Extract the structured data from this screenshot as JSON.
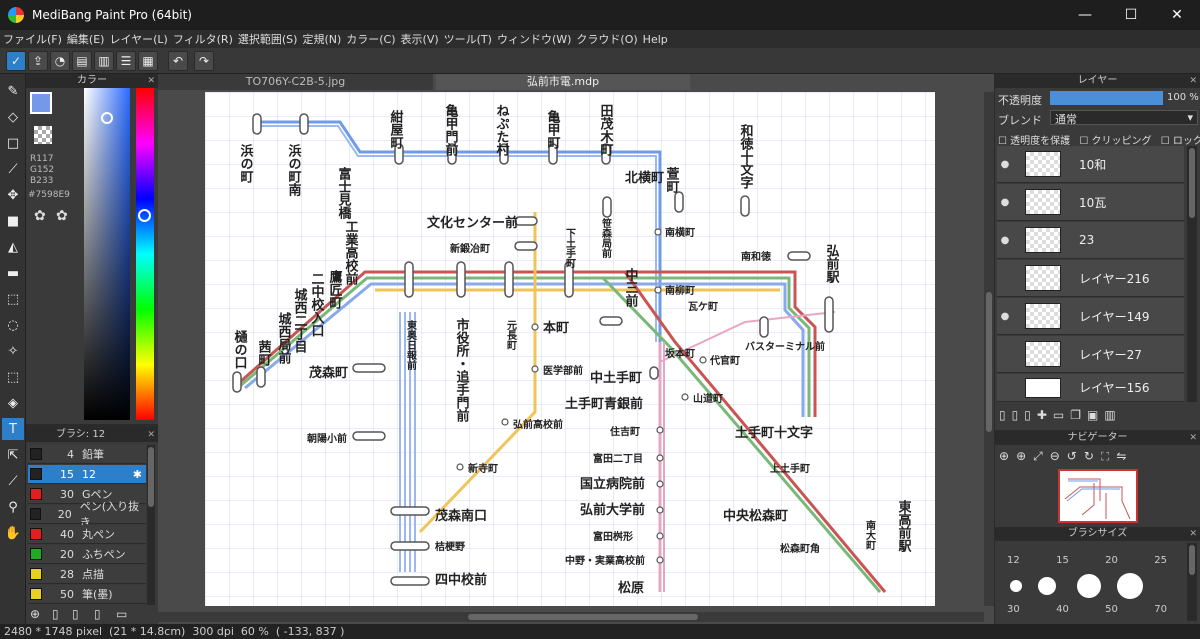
{
  "window": {
    "title": "MediBang Paint Pro (64bit)",
    "minimize": "—",
    "maximize": "☐",
    "close": "✕"
  },
  "menu": [
    "ファイル(F)",
    "編集(E)",
    "レイヤー(L)",
    "フィルタ(R)",
    "選択範囲(S)",
    "定規(N)",
    "カラー(C)",
    "表示(V)",
    "ツール(T)",
    "ウィンドウ(W)",
    "クラウド(O)",
    "Help"
  ],
  "color_panel": {
    "title": "カラー",
    "r": "R117",
    "g": "G152",
    "b": "B233",
    "hex": "#7598E9",
    "current_color": "#7598E9"
  },
  "brush_panel": {
    "title": "ブラシ: 12",
    "items": [
      {
        "size": "4",
        "name": "鉛筆",
        "color": "#222222"
      },
      {
        "size": "15",
        "name": "12",
        "color": "#222222"
      },
      {
        "size": "30",
        "name": "Gペン",
        "color": "#e02020"
      },
      {
        "size": "20",
        "name": "ペン(入り抜き",
        "color": "#222222"
      },
      {
        "size": "40",
        "name": "丸ペン",
        "color": "#e02020"
      },
      {
        "size": "20",
        "name": "ふちペン",
        "color": "#22aa22"
      },
      {
        "size": "28",
        "name": "点描",
        "color": "#e8d020"
      },
      {
        "size": "50",
        "name": "筆(墨)",
        "color": "#e8d020"
      }
    ]
  },
  "tabs": {
    "inactive": "TO706Y-C2B-5.jpg",
    "active": "弘前市電.mdp"
  },
  "layer_panel": {
    "title": "レイヤー",
    "opacity_label": "不透明度",
    "opacity_value": "100 %",
    "blend_label": "ブレンド",
    "blend_value": "通常",
    "protect_label": "透明度を保護",
    "clip_label": "クリッピング",
    "lock_label": "ロック",
    "layers": [
      {
        "name": "10和",
        "visible": true
      },
      {
        "name": "10瓦",
        "visible": true
      },
      {
        "name": "23",
        "visible": true
      },
      {
        "name": "レイヤー216",
        "visible": false
      },
      {
        "name": "レイヤー149",
        "visible": true
      },
      {
        "name": "レイヤー27",
        "visible": false
      },
      {
        "name": "レイヤー156",
        "visible": false
      }
    ]
  },
  "navigator": {
    "title": "ナビゲーター"
  },
  "brush_size": {
    "title": "ブラシサイズ",
    "sizes_top": [
      "12",
      "15",
      "20",
      "25"
    ],
    "sizes_bottom": [
      "30",
      "40",
      "50",
      "70"
    ]
  },
  "status": {
    "dims": "2480 * 1748 pixel",
    "cm": "(21 * 14.8cm)",
    "dpi": "300 dpi",
    "zoom": "60 %",
    "coord": "( -133, 837 )"
  },
  "map": {
    "stations_v": [
      "浜の町",
      "浜の町南",
      "富士見橋",
      "紺屋町",
      "亀甲門前",
      "ねぷた村",
      "亀甲町",
      "田茂木町",
      "北横町",
      "和徳十文字",
      "工業高校前",
      "鷹匠町",
      "二中校入口",
      "城西二丁目",
      "城西局前",
      "茜町",
      "樋の口",
      "東奥日報前",
      "市役所・追手門前",
      "元長町",
      "下土手町",
      "笹森局前",
      "中三前",
      "弘前駅",
      "東高前駅",
      "南大町"
    ],
    "stations_h": [
      "文化センター前",
      "新鍛冶町",
      "本町",
      "医学部前",
      "弘前高校前",
      "新寺町",
      "茂森町",
      "朝陽小前",
      "茂森南口",
      "桔梗野",
      "四中校前",
      "南横町",
      "南柳町",
      "南和徳",
      "瓦ケ町",
      "バスターミナル前",
      "坂本町",
      "代官町",
      "中土手町",
      "土手町青銀前",
      "山道町",
      "住吉町",
      "富田二丁目",
      "国立病院前",
      "弘前大学前",
      "富田桝形",
      "中野・実業高校前",
      "松原",
      "土手町十文字",
      "上土手町",
      "中央松森町",
      "松森町角",
      "萱町"
    ]
  }
}
